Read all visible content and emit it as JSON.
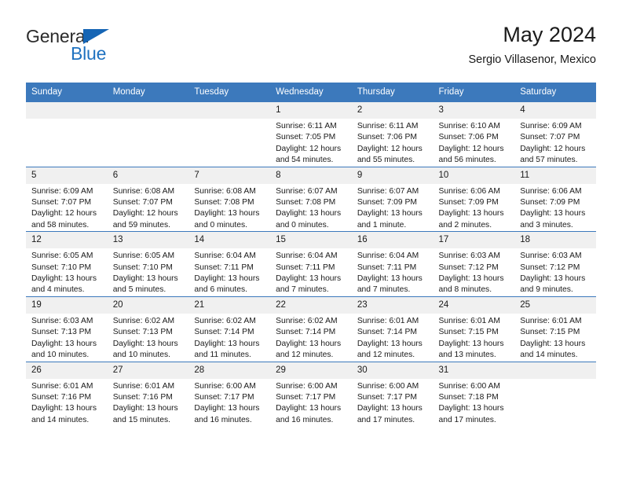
{
  "brand": {
    "line1": "General",
    "line2": "Blue",
    "triangle_color": "#1565b5",
    "blue_color": "#1f72c0"
  },
  "header": {
    "title": "May 2024",
    "subtitle": "Sergio Villasenor, Mexico"
  },
  "theme": {
    "header_bg": "#3c79bc",
    "header_text": "#ffffff",
    "daynum_bg": "#f0f0f0",
    "grid_line": "#3c79bc"
  },
  "weekday_headers": [
    "Sunday",
    "Monday",
    "Tuesday",
    "Wednesday",
    "Thursday",
    "Friday",
    "Saturday"
  ],
  "labels": {
    "sunrise_prefix": "Sunrise: ",
    "sunset_prefix": "Sunset: ",
    "daylight_prefix": "Daylight: "
  },
  "weeks": [
    [
      {
        "day": "",
        "empty": true
      },
      {
        "day": "",
        "empty": true
      },
      {
        "day": "",
        "empty": true
      },
      {
        "day": "1",
        "sunrise": "Sunrise: 6:11 AM",
        "sunset": "Sunset: 7:05 PM",
        "daylight_line1": "Daylight: 12 hours",
        "daylight_line2": "and 54 minutes."
      },
      {
        "day": "2",
        "sunrise": "Sunrise: 6:11 AM",
        "sunset": "Sunset: 7:06 PM",
        "daylight_line1": "Daylight: 12 hours",
        "daylight_line2": "and 55 minutes."
      },
      {
        "day": "3",
        "sunrise": "Sunrise: 6:10 AM",
        "sunset": "Sunset: 7:06 PM",
        "daylight_line1": "Daylight: 12 hours",
        "daylight_line2": "and 56 minutes."
      },
      {
        "day": "4",
        "sunrise": "Sunrise: 6:09 AM",
        "sunset": "Sunset: 7:07 PM",
        "daylight_line1": "Daylight: 12 hours",
        "daylight_line2": "and 57 minutes."
      }
    ],
    [
      {
        "day": "5",
        "sunrise": "Sunrise: 6:09 AM",
        "sunset": "Sunset: 7:07 PM",
        "daylight_line1": "Daylight: 12 hours",
        "daylight_line2": "and 58 minutes."
      },
      {
        "day": "6",
        "sunrise": "Sunrise: 6:08 AM",
        "sunset": "Sunset: 7:07 PM",
        "daylight_line1": "Daylight: 12 hours",
        "daylight_line2": "and 59 minutes."
      },
      {
        "day": "7",
        "sunrise": "Sunrise: 6:08 AM",
        "sunset": "Sunset: 7:08 PM",
        "daylight_line1": "Daylight: 13 hours",
        "daylight_line2": "and 0 minutes."
      },
      {
        "day": "8",
        "sunrise": "Sunrise: 6:07 AM",
        "sunset": "Sunset: 7:08 PM",
        "daylight_line1": "Daylight: 13 hours",
        "daylight_line2": "and 0 minutes."
      },
      {
        "day": "9",
        "sunrise": "Sunrise: 6:07 AM",
        "sunset": "Sunset: 7:09 PM",
        "daylight_line1": "Daylight: 13 hours",
        "daylight_line2": "and 1 minute."
      },
      {
        "day": "10",
        "sunrise": "Sunrise: 6:06 AM",
        "sunset": "Sunset: 7:09 PM",
        "daylight_line1": "Daylight: 13 hours",
        "daylight_line2": "and 2 minutes."
      },
      {
        "day": "11",
        "sunrise": "Sunrise: 6:06 AM",
        "sunset": "Sunset: 7:09 PM",
        "daylight_line1": "Daylight: 13 hours",
        "daylight_line2": "and 3 minutes."
      }
    ],
    [
      {
        "day": "12",
        "sunrise": "Sunrise: 6:05 AM",
        "sunset": "Sunset: 7:10 PM",
        "daylight_line1": "Daylight: 13 hours",
        "daylight_line2": "and 4 minutes."
      },
      {
        "day": "13",
        "sunrise": "Sunrise: 6:05 AM",
        "sunset": "Sunset: 7:10 PM",
        "daylight_line1": "Daylight: 13 hours",
        "daylight_line2": "and 5 minutes."
      },
      {
        "day": "14",
        "sunrise": "Sunrise: 6:04 AM",
        "sunset": "Sunset: 7:11 PM",
        "daylight_line1": "Daylight: 13 hours",
        "daylight_line2": "and 6 minutes."
      },
      {
        "day": "15",
        "sunrise": "Sunrise: 6:04 AM",
        "sunset": "Sunset: 7:11 PM",
        "daylight_line1": "Daylight: 13 hours",
        "daylight_line2": "and 7 minutes."
      },
      {
        "day": "16",
        "sunrise": "Sunrise: 6:04 AM",
        "sunset": "Sunset: 7:11 PM",
        "daylight_line1": "Daylight: 13 hours",
        "daylight_line2": "and 7 minutes."
      },
      {
        "day": "17",
        "sunrise": "Sunrise: 6:03 AM",
        "sunset": "Sunset: 7:12 PM",
        "daylight_line1": "Daylight: 13 hours",
        "daylight_line2": "and 8 minutes."
      },
      {
        "day": "18",
        "sunrise": "Sunrise: 6:03 AM",
        "sunset": "Sunset: 7:12 PM",
        "daylight_line1": "Daylight: 13 hours",
        "daylight_line2": "and 9 minutes."
      }
    ],
    [
      {
        "day": "19",
        "sunrise": "Sunrise: 6:03 AM",
        "sunset": "Sunset: 7:13 PM",
        "daylight_line1": "Daylight: 13 hours",
        "daylight_line2": "and 10 minutes."
      },
      {
        "day": "20",
        "sunrise": "Sunrise: 6:02 AM",
        "sunset": "Sunset: 7:13 PM",
        "daylight_line1": "Daylight: 13 hours",
        "daylight_line2": "and 10 minutes."
      },
      {
        "day": "21",
        "sunrise": "Sunrise: 6:02 AM",
        "sunset": "Sunset: 7:14 PM",
        "daylight_line1": "Daylight: 13 hours",
        "daylight_line2": "and 11 minutes."
      },
      {
        "day": "22",
        "sunrise": "Sunrise: 6:02 AM",
        "sunset": "Sunset: 7:14 PM",
        "daylight_line1": "Daylight: 13 hours",
        "daylight_line2": "and 12 minutes."
      },
      {
        "day": "23",
        "sunrise": "Sunrise: 6:01 AM",
        "sunset": "Sunset: 7:14 PM",
        "daylight_line1": "Daylight: 13 hours",
        "daylight_line2": "and 12 minutes."
      },
      {
        "day": "24",
        "sunrise": "Sunrise: 6:01 AM",
        "sunset": "Sunset: 7:15 PM",
        "daylight_line1": "Daylight: 13 hours",
        "daylight_line2": "and 13 minutes."
      },
      {
        "day": "25",
        "sunrise": "Sunrise: 6:01 AM",
        "sunset": "Sunset: 7:15 PM",
        "daylight_line1": "Daylight: 13 hours",
        "daylight_line2": "and 14 minutes."
      }
    ],
    [
      {
        "day": "26",
        "sunrise": "Sunrise: 6:01 AM",
        "sunset": "Sunset: 7:16 PM",
        "daylight_line1": "Daylight: 13 hours",
        "daylight_line2": "and 14 minutes."
      },
      {
        "day": "27",
        "sunrise": "Sunrise: 6:01 AM",
        "sunset": "Sunset: 7:16 PM",
        "daylight_line1": "Daylight: 13 hours",
        "daylight_line2": "and 15 minutes."
      },
      {
        "day": "28",
        "sunrise": "Sunrise: 6:00 AM",
        "sunset": "Sunset: 7:17 PM",
        "daylight_line1": "Daylight: 13 hours",
        "daylight_line2": "and 16 minutes."
      },
      {
        "day": "29",
        "sunrise": "Sunrise: 6:00 AM",
        "sunset": "Sunset: 7:17 PM",
        "daylight_line1": "Daylight: 13 hours",
        "daylight_line2": "and 16 minutes."
      },
      {
        "day": "30",
        "sunrise": "Sunrise: 6:00 AM",
        "sunset": "Sunset: 7:17 PM",
        "daylight_line1": "Daylight: 13 hours",
        "daylight_line2": "and 17 minutes."
      },
      {
        "day": "31",
        "sunrise": "Sunrise: 6:00 AM",
        "sunset": "Sunset: 7:18 PM",
        "daylight_line1": "Daylight: 13 hours",
        "daylight_line2": "and 17 minutes."
      },
      {
        "day": "",
        "empty": true
      }
    ]
  ]
}
